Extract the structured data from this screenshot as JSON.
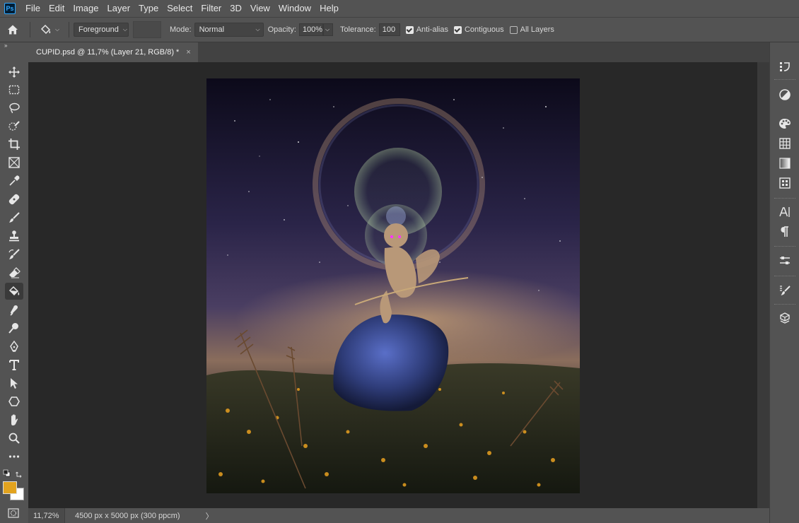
{
  "app": {
    "logo_text": "Ps"
  },
  "menu": [
    "File",
    "Edit",
    "Image",
    "Layer",
    "Type",
    "Select",
    "Filter",
    "3D",
    "View",
    "Window",
    "Help"
  ],
  "options": {
    "fill_source": "Foreground",
    "mode_label": "Mode:",
    "mode_value": "Normal",
    "opacity_label": "Opacity:",
    "opacity_value": "100%",
    "tolerance_label": "Tolerance:",
    "tolerance_value": "100",
    "anti_alias_label": "Anti-alias",
    "anti_alias_checked": true,
    "contiguous_label": "Contiguous",
    "contiguous_checked": true,
    "all_layers_label": "All Layers",
    "all_layers_checked": false
  },
  "document": {
    "tab_title": "CUPID.psd @ 11,7% (Layer 21, RGB/8) *",
    "close_glyph": "×"
  },
  "status": {
    "zoom": "11,72%",
    "doc_info": "4500 px x 5000 px (300 ppcm)",
    "arrow": "〉"
  },
  "colors": {
    "foreground": "#e2a31f",
    "background": "#ffffff",
    "ui_bg": "#535353",
    "canvas_bg": "#282828"
  },
  "tools": [
    "move-icon",
    "marquee-icon",
    "lasso-icon",
    "quick-select-icon",
    "crop-icon",
    "frame-icon",
    "eyedropper-icon",
    "healing-icon",
    "brush-icon",
    "stamp-icon",
    "history-brush-icon",
    "eraser-icon",
    "paint-bucket-icon",
    "smudge-icon",
    "dodge-icon",
    "pen-icon",
    "type-icon",
    "path-select-icon",
    "shape-icon",
    "hand-icon",
    "zoom-icon",
    "more-tools-icon"
  ],
  "active_tool": "paint-bucket-icon",
  "panels": [
    "history-icon",
    "adjustments-icon",
    "swatches-icon",
    "patterns-icon",
    "gradients-icon",
    "libraries-icon",
    "character-icon",
    "paragraph-icon",
    "properties-icon",
    "brushes-icon",
    "layers-3d-icon"
  ]
}
